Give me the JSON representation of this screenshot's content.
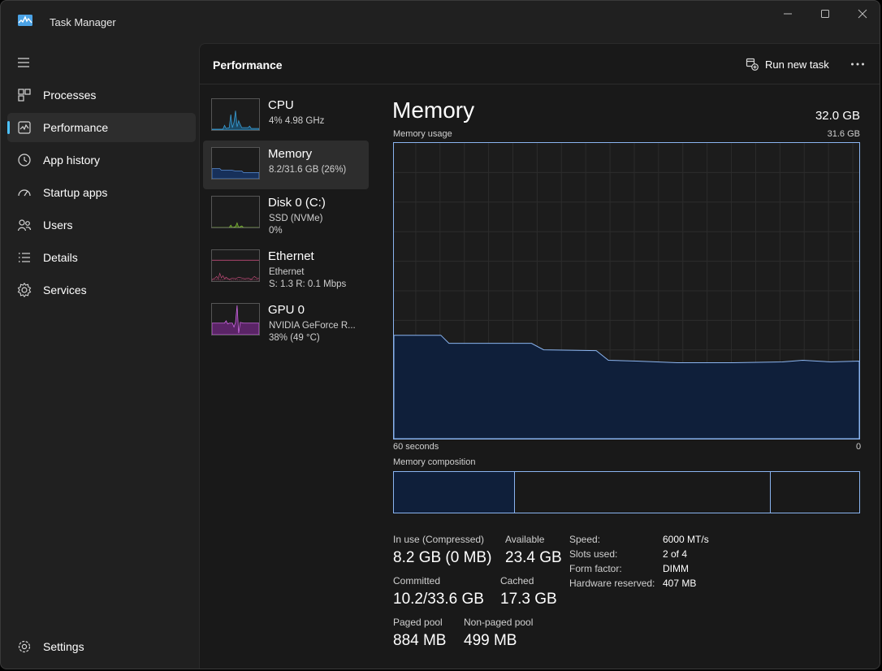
{
  "window": {
    "title": "Task Manager"
  },
  "nav": {
    "items": [
      {
        "label": "Processes",
        "icon": "processes-icon"
      },
      {
        "label": "Performance",
        "icon": "performance-icon",
        "active": true
      },
      {
        "label": "App history",
        "icon": "app-history-icon"
      },
      {
        "label": "Startup apps",
        "icon": "startup-apps-icon"
      },
      {
        "label": "Users",
        "icon": "users-icon"
      },
      {
        "label": "Details",
        "icon": "details-icon"
      },
      {
        "label": "Services",
        "icon": "services-icon"
      }
    ],
    "settings_label": "Settings"
  },
  "header": {
    "title": "Performance",
    "run_new_task_label": "Run new task"
  },
  "devices": [
    {
      "name": "CPU",
      "sub1": "4% 4.98 GHz",
      "sub2": "",
      "color": "#3b9fd6"
    },
    {
      "name": "Memory",
      "sub1": "8.2/31.6 GB (26%)",
      "sub2": "",
      "color": "#5a8fd8"
    },
    {
      "name": "Disk 0 (C:)",
      "sub1": "SSD (NVMe)",
      "sub2": "0%",
      "color": "#7fb33a"
    },
    {
      "name": "Ethernet",
      "sub1": "Ethernet",
      "sub2": "S: 1.3 R: 0.1 Mbps",
      "color": "#c04a78"
    },
    {
      "name": "GPU 0",
      "sub1": "NVIDIA GeForce R...",
      "sub2": "38% (49 °C)",
      "color": "#b04ac8"
    }
  ],
  "detail": {
    "heading": "Memory",
    "total": "32.0 GB",
    "usage_label": "Memory usage",
    "usage_max": "31.6 GB",
    "time_left": "60 seconds",
    "time_right": "0",
    "composition_label": "Memory composition",
    "stats": {
      "in_use_label": "In use (Compressed)",
      "in_use_value": "8.2 GB (0 MB)",
      "available_label": "Available",
      "available_value": "23.4 GB",
      "committed_label": "Committed",
      "committed_value": "10.2/33.6 GB",
      "cached_label": "Cached",
      "cached_value": "17.3 GB",
      "paged_label": "Paged pool",
      "paged_value": "884 MB",
      "nonpaged_label": "Non-paged pool",
      "nonpaged_value": "499 MB"
    },
    "specs": [
      {
        "label": "Speed:",
        "value": "6000 MT/s"
      },
      {
        "label": "Slots used:",
        "value": "2 of 4"
      },
      {
        "label": "Form factor:",
        "value": "DIMM"
      },
      {
        "label": "Hardware reserved:",
        "value": "407 MB"
      }
    ]
  },
  "colors": {
    "accent": "#4cc2ff",
    "graph_line": "#8ab4f0",
    "graph_fill": "#0f1f3a"
  }
}
